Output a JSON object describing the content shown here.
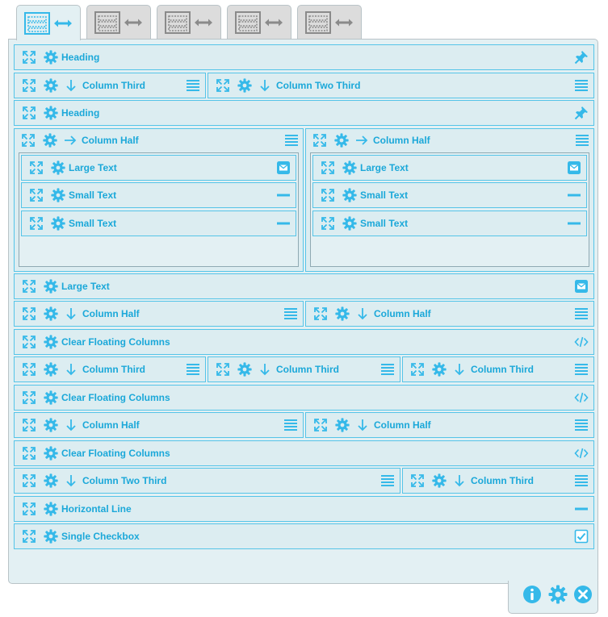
{
  "footer": {
    "info_icon": "info-icon",
    "settings_icon": "gear-icon",
    "close_icon": "close-icon"
  },
  "tabs": [
    {
      "active": true
    },
    {
      "active": false
    },
    {
      "active": false
    },
    {
      "active": false
    },
    {
      "active": false
    }
  ],
  "colors": {
    "accent": "#35b9e9",
    "label": "#1ba8d9",
    "row_border": "#55c4e8",
    "row_bg": "#dcedf1",
    "panel_bg": "#e3f0f3",
    "inactive_icon": "#8a8a8a"
  },
  "rows": [
    {
      "items": [
        {
          "label": "Heading",
          "icon": "pin-icon"
        }
      ]
    },
    {
      "items": [
        {
          "label": "Column Third",
          "dir": "down",
          "icon": "lines-icon"
        },
        {
          "label": "Column Two Third",
          "dir": "down",
          "icon": "lines-icon"
        }
      ]
    },
    {
      "items": [
        {
          "label": "Heading",
          "icon": "pin-icon"
        }
      ]
    },
    {
      "columns": [
        {
          "label": "Column Half",
          "dir": "right",
          "icon": "lines-icon",
          "children": [
            {
              "label": "Large Text",
              "icon": "envelope-icon"
            },
            {
              "label": "Small Text",
              "icon": "dash-icon"
            },
            {
              "label": "Small Text",
              "icon": "dash-icon"
            }
          ]
        },
        {
          "label": "Column Half",
          "dir": "right",
          "icon": "lines-icon",
          "children": [
            {
              "label": "Large Text",
              "icon": "envelope-icon"
            },
            {
              "label": "Small Text",
              "icon": "dash-icon"
            },
            {
              "label": "Small Text",
              "icon": "dash-icon"
            }
          ]
        }
      ]
    },
    {
      "items": [
        {
          "label": "Large Text",
          "icon": "envelope-icon"
        }
      ]
    },
    {
      "items": [
        {
          "label": "Column Half",
          "dir": "down",
          "icon": "lines-icon"
        },
        {
          "label": "Column Half",
          "dir": "down",
          "icon": "lines-icon"
        }
      ]
    },
    {
      "items": [
        {
          "label": "Clear Floating Columns",
          "icon": "code-icon"
        }
      ]
    },
    {
      "items": [
        {
          "label": "Column Third",
          "dir": "down",
          "icon": "lines-icon"
        },
        {
          "label": "Column Third",
          "dir": "down",
          "icon": "lines-icon"
        },
        {
          "label": "Column Third",
          "dir": "down",
          "icon": "lines-icon"
        }
      ]
    },
    {
      "items": [
        {
          "label": "Clear Floating Columns",
          "icon": "code-icon"
        }
      ]
    },
    {
      "items": [
        {
          "label": "Column Half",
          "dir": "down",
          "icon": "lines-icon"
        },
        {
          "label": "Column Half",
          "dir": "down",
          "icon": "lines-icon"
        }
      ]
    },
    {
      "items": [
        {
          "label": "Clear Floating Columns",
          "icon": "code-icon"
        }
      ]
    },
    {
      "items": [
        {
          "label": "Column Two Third",
          "dir": "down",
          "icon": "lines-icon"
        },
        {
          "label": "Column Third",
          "dir": "down",
          "icon": "lines-icon"
        }
      ]
    },
    {
      "items": [
        {
          "label": "Horizontal Line",
          "icon": "dash-icon"
        }
      ]
    },
    {
      "items": [
        {
          "label": "Single Checkbox",
          "icon": "checkbox-icon"
        }
      ]
    }
  ]
}
